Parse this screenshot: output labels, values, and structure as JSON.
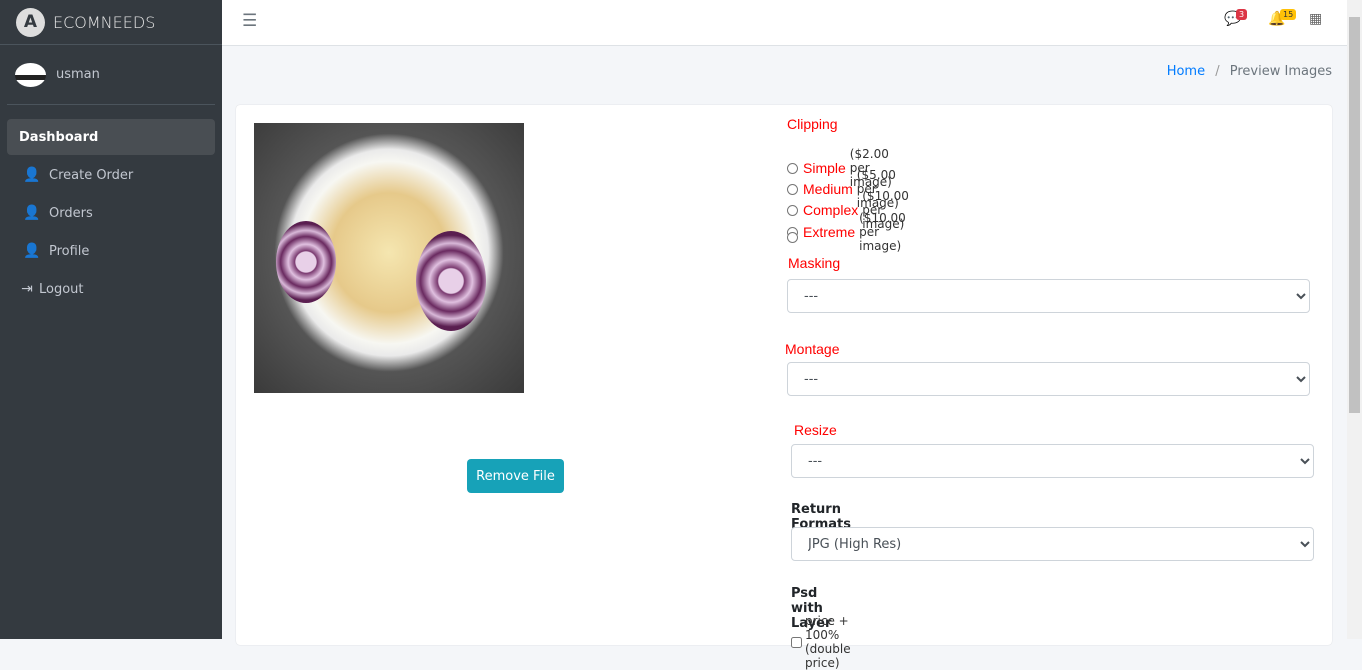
{
  "brand": {
    "name": "ECOMNEEDS",
    "logo_letter": "A"
  },
  "user": {
    "name": "usman"
  },
  "nav": [
    {
      "label": "Dashboard",
      "icon": "dashboard"
    },
    {
      "label": "Create Order",
      "icon": "user-icon"
    },
    {
      "label": "Orders",
      "icon": "user-icon"
    },
    {
      "label": "Profile",
      "icon": "user-icon"
    },
    {
      "label": "Logout",
      "icon": "logout-icon"
    }
  ],
  "topbar": {
    "messages_count": "3",
    "notifications_count": "15",
    "colors": {
      "messages_badge": "#dc3545",
      "notifications_badge": "#ffc107"
    }
  },
  "breadcrumb": {
    "home": "Home",
    "separator": "/",
    "current": "Preview Images"
  },
  "preview": {
    "remove_label": "Remove File"
  },
  "form": {
    "clipping": {
      "label": "Clipping",
      "options": [
        {
          "name": "Simple",
          "price": "($2.00 per image)"
        },
        {
          "name": "Medium",
          "price": "($5.00 per image)"
        },
        {
          "name": "Complex",
          "price": "($10.00 per image)"
        },
        {
          "name": "Extreme",
          "price": "($10.00 per image)"
        },
        {
          "name": "",
          "price": ""
        }
      ]
    },
    "masking": {
      "label": "Masking",
      "value": "---"
    },
    "montage": {
      "label": "Montage",
      "value": "---"
    },
    "resize": {
      "label": "Resize",
      "value": "---"
    },
    "return_formats": {
      "label": "Return Formats",
      "value": "JPG (High Res)"
    },
    "psd": {
      "label": "Psd with Layer",
      "checkbox_label": "price + 100% (double price)"
    }
  }
}
